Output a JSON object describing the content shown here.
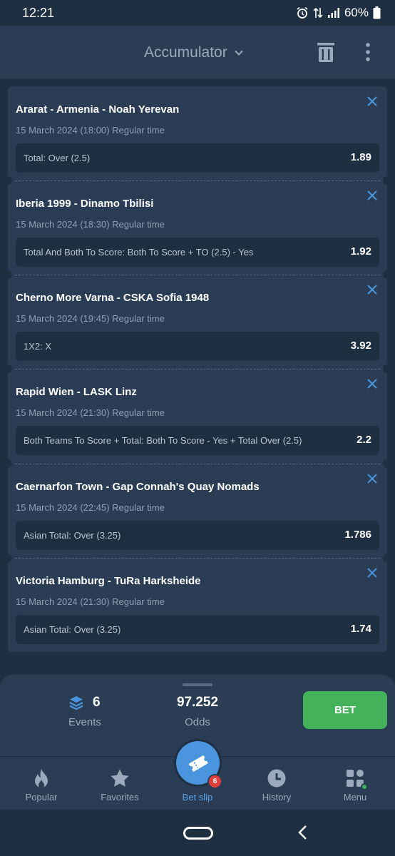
{
  "status_bar": {
    "time": "12:21",
    "battery": "60%"
  },
  "header": {
    "title": "Accumulator"
  },
  "bets": [
    {
      "match": "Ararat - Armenia - Noah Yerevan",
      "datetime": "15 March 2024 (18:00) Regular time",
      "market": "Total: Over (2.5)",
      "odds": "1.89"
    },
    {
      "match": "Iberia 1999 - Dinamo Tbilisi",
      "datetime": "15 March 2024 (18:30) Regular time",
      "market": "Total And Both To Score: Both To Score + TO (2.5) - Yes",
      "odds": "1.92"
    },
    {
      "match": "Cherno More Varna - CSKA Sofia 1948",
      "datetime": "15 March 2024 (19:45) Regular time",
      "market": "1X2: X",
      "odds": "3.92"
    },
    {
      "match": "Rapid Wien - LASK Linz",
      "datetime": "15 March 2024 (21:30) Regular time",
      "market": "Both Teams To Score + Total: Both To Score - Yes + Total Over (2.5)",
      "odds": "2.2"
    },
    {
      "match": "Caernarfon Town - Gap Connah's Quay Nomads",
      "datetime": "15 March 2024 (22:45) Regular time",
      "market": "Asian Total: Over (3.25)",
      "odds": "1.786"
    },
    {
      "match": "Victoria Hamburg - TuRa Harksheide",
      "datetime": "15 March 2024 (21:30) Regular time",
      "market": "Asian Total: Over (3.25)",
      "odds": "1.74"
    }
  ],
  "summary": {
    "events_count": "6",
    "events_label": "Events",
    "odds_value": "97.252",
    "odds_label": "Odds",
    "bet_label": "BET"
  },
  "nav": {
    "popular": "Popular",
    "favorites": "Favorites",
    "betslip": "Bet slip",
    "betslip_badge": "6",
    "history": "History",
    "menu": "Menu"
  },
  "colors": {
    "accent": "#4a95dd",
    "bet_button": "#44b25a",
    "badge": "#e13e3e",
    "card": "#2a3d55",
    "background": "#1f2f42"
  },
  "icons": {
    "close": "close-icon",
    "trash": "trash-icon",
    "more": "more-vertical-icon",
    "layers": "layers-icon",
    "fire": "fire-icon",
    "star": "star-icon",
    "ticket": "ticket-icon",
    "clock": "clock-icon",
    "grid": "grid-icon"
  }
}
